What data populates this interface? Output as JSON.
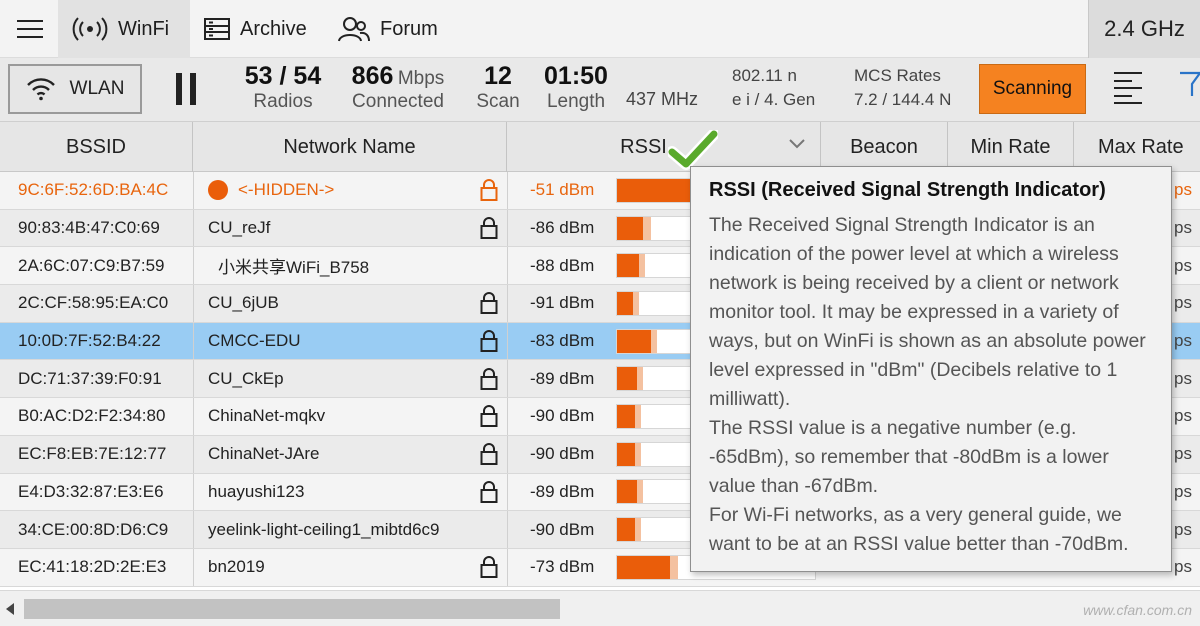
{
  "nav": {
    "tabs": [
      {
        "label": "WinFi",
        "icon": "signal-broadcast-icon"
      },
      {
        "label": "Archive",
        "icon": "archive-icon"
      },
      {
        "label": "Forum",
        "icon": "people-icon"
      }
    ],
    "band": "2.4 GHz"
  },
  "status": {
    "wlan_label": "WLAN",
    "radios_value": "53 / 54",
    "radios_label": "Radios",
    "connected_value": "866",
    "connected_unit": "Mbps",
    "connected_label": "Connected",
    "scan_value": "12",
    "scan_label": "Scan",
    "length_value": "01:50",
    "length_label": "Length",
    "freq": "437 MHz",
    "standard_line1": "802.11 n",
    "standard_line2": "e i / 4. Gen",
    "mcs_line1": "MCS Rates",
    "mcs_line2": "7.2 / 144.4 N",
    "scanning_label": "Scanning"
  },
  "columns": {
    "bssid": "BSSID",
    "network": "Network Name",
    "rssi": "RSSI",
    "beacon": "Beacon",
    "min_rate": "Min Rate",
    "max_rate": "Max Rate"
  },
  "colors": {
    "accent": "#f58220",
    "bar_fill": "#ea5d0a",
    "hidden_text": "#e8650e",
    "selected_row": "#99ccf3",
    "check_green": "#5aaa2c"
  },
  "rows": [
    {
      "bssid": "9C:6F:52:6D:BA:4C",
      "name": "<-HIDDEN->",
      "locked": true,
      "rssi": "-51 dBm",
      "level": 0.62,
      "peak": 0.66,
      "hidden": true,
      "selected": false,
      "tail": "ps"
    },
    {
      "bssid": "90:83:4B:47:C0:69",
      "name": "CU_reJf",
      "locked": true,
      "rssi": "-86 dBm",
      "level": 0.13,
      "peak": 0.17,
      "hidden": false,
      "selected": false,
      "tail": "ps"
    },
    {
      "bssid": "2A:6C:07:C9:B7:59",
      "name": "小米共享WiFi_B758",
      "locked": false,
      "rssi": "-88 dBm",
      "level": 0.11,
      "peak": 0.14,
      "hidden": false,
      "selected": false,
      "tail": "ps"
    },
    {
      "bssid": "2C:CF:58:95:EA:C0",
      "name": "CU_6jUB",
      "locked": true,
      "rssi": "-91 dBm",
      "level": 0.08,
      "peak": 0.11,
      "hidden": false,
      "selected": false,
      "tail": "ps"
    },
    {
      "bssid": "10:0D:7F:52:B4:22",
      "name": "CMCC-EDU",
      "locked": true,
      "rssi": "-83 dBm",
      "level": 0.17,
      "peak": 0.2,
      "hidden": false,
      "selected": true,
      "tail": "ps"
    },
    {
      "bssid": "DC:71:37:39:F0:91",
      "name": "CU_CkEp",
      "locked": true,
      "rssi": "-89 dBm",
      "level": 0.1,
      "peak": 0.13,
      "hidden": false,
      "selected": false,
      "tail": "ps"
    },
    {
      "bssid": "B0:AC:D2:F2:34:80",
      "name": "ChinaNet-mqkv",
      "locked": true,
      "rssi": "-90 dBm",
      "level": 0.09,
      "peak": 0.12,
      "hidden": false,
      "selected": false,
      "tail": "ps"
    },
    {
      "bssid": "EC:F8:EB:7E:12:77",
      "name": "ChinaNet-JAre",
      "locked": true,
      "rssi": "-90 dBm",
      "level": 0.09,
      "peak": 0.12,
      "hidden": false,
      "selected": false,
      "tail": "ps"
    },
    {
      "bssid": "E4:D3:32:87:E3:E6",
      "name": "huayushi123",
      "locked": true,
      "rssi": "-89 dBm",
      "level": 0.1,
      "peak": 0.13,
      "hidden": false,
      "selected": false,
      "tail": "ps"
    },
    {
      "bssid": "34:CE:00:8D:D6:C9",
      "name": "yeelink-light-ceiling1_mibtd6c9",
      "locked": false,
      "rssi": "-90 dBm",
      "level": 0.09,
      "peak": 0.12,
      "hidden": false,
      "selected": false,
      "tail": "ps"
    },
    {
      "bssid": "EC:41:18:2D:2E:E3",
      "name": "bn2019",
      "locked": true,
      "rssi": "-73 dBm",
      "level": 0.27,
      "peak": 0.31,
      "hidden": false,
      "selected": false,
      "tail": "ps"
    }
  ],
  "tooltip": {
    "title": "RSSI (Received Signal Strength Indicator)",
    "p1": "The Received Signal Strength Indicator is an indication of the power level at which a wireless network is being received by a client or network monitor tool. It may be expressed in a variety of ways, but on WinFi is shown as an absolute power level expressed in \"dBm\" (Decibels relative to 1 milliwatt).",
    "p2": "The RSSI value is a negative number (e.g. -65dBm), so remember that -80dBm is a lower value than -67dBm.",
    "p3": "For Wi-Fi networks, as a very general guide, we want to be at an RSSI value better than -70dBm."
  },
  "watermark": "www.cfan.com.cn"
}
